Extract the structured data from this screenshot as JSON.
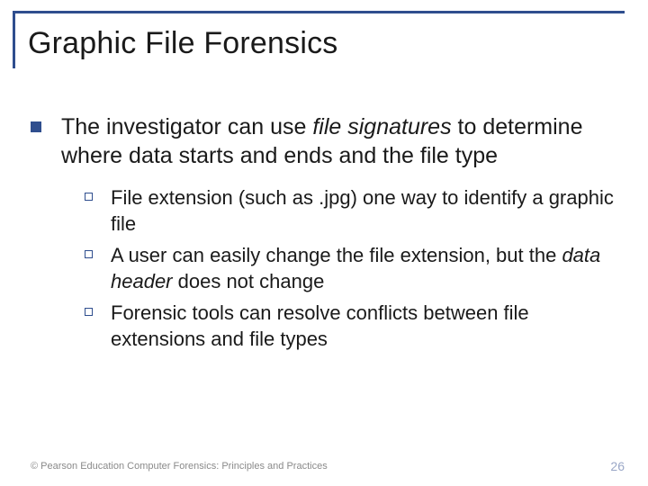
{
  "title": "Graphic File Forensics",
  "main": {
    "text_pre": "The investigator can use ",
    "text_ital": "file signatures",
    "text_post": " to determine where data starts and ends and the file type"
  },
  "subs": [
    {
      "pre": "File extension (such as .jpg) one way to identify a graphic file",
      "ital": "",
      "post": ""
    },
    {
      "pre": "A user can easily change the file extension, but the ",
      "ital": "data header",
      "post": " does not change"
    },
    {
      "pre": "Forensic tools can resolve conflicts between file extensions and file types",
      "ital": "",
      "post": ""
    }
  ],
  "footer": "© Pearson Education  Computer Forensics: Principles and Practices",
  "page_number": "26"
}
